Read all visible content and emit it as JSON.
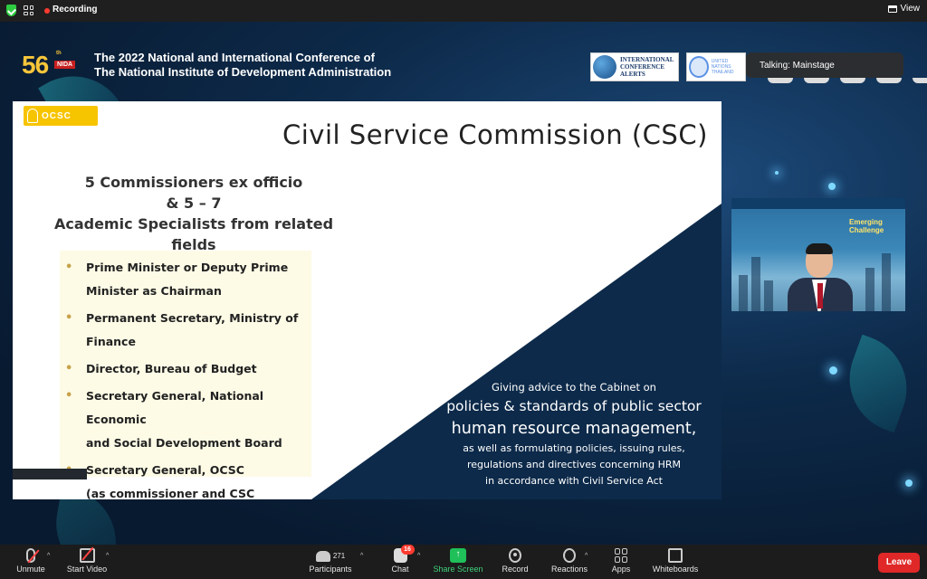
{
  "topbar": {
    "recording_label": "Recording",
    "view_label": "View"
  },
  "banner": {
    "anniversary_number": "56",
    "anniversary_suffix": "th",
    "org_tag": "NIDA",
    "title_line1": "The 2022 National and International Conference of",
    "title_line2": "The National Institute of Development Administration",
    "sponsor1_lines": [
      "INTERNATIONAL",
      "CONFERENCE",
      "ALERTS"
    ],
    "sponsor2_lines": [
      "UNITED NATIONS",
      "THAILAND"
    ]
  },
  "talking_indicator": "Talking: Mainstage",
  "slide": {
    "logo_text": "OCSC",
    "title": "Civil Service Commission (CSC)",
    "commissioners": [
      "5 Commissioners ex officio",
      "& 5 – 7",
      "Academic Specialists from related fields"
    ],
    "bullets": [
      [
        "Prime Minister or Deputy Prime",
        "Minister as Chairman"
      ],
      [
        "Permanent Secretary, Ministry of",
        "Finance"
      ],
      [
        "Director, Bureau of Budget"
      ],
      [
        "Secretary General, National Economic",
        "and Social Development Board"
      ],
      [
        "Secretary General, OCSC",
        "(as commissioner and CSC secretary)"
      ]
    ],
    "advice_line1": "Giving advice to the Cabinet on",
    "advice_line2": "policies & standards of public sector",
    "advice_line3": "human resource management,",
    "advice_rest": [
      "as well as formulating policies, issuing rules,",
      "regulations and directives concerning HRM",
      "in accordance with Civil Service Act"
    ]
  },
  "speaker_thumb": {
    "slide_heading": "Emerging Challenge"
  },
  "toolbar": {
    "unmute": "Unmute",
    "start_video": "Start Video",
    "participants_count": "271",
    "participants": "Participants",
    "chat": "Chat",
    "chat_badge": "16",
    "share_screen": "Share Screen",
    "record": "Record",
    "reactions": "Reactions",
    "apps": "Apps",
    "whiteboards": "Whiteboards",
    "leave": "Leave"
  },
  "colors": {
    "share_green": "#1fbf5a",
    "leave_red": "#e02828",
    "recording_red": "#ff3b30",
    "slide_navy": "#0d2a4a",
    "ocsc_yellow": "#f7c400"
  }
}
